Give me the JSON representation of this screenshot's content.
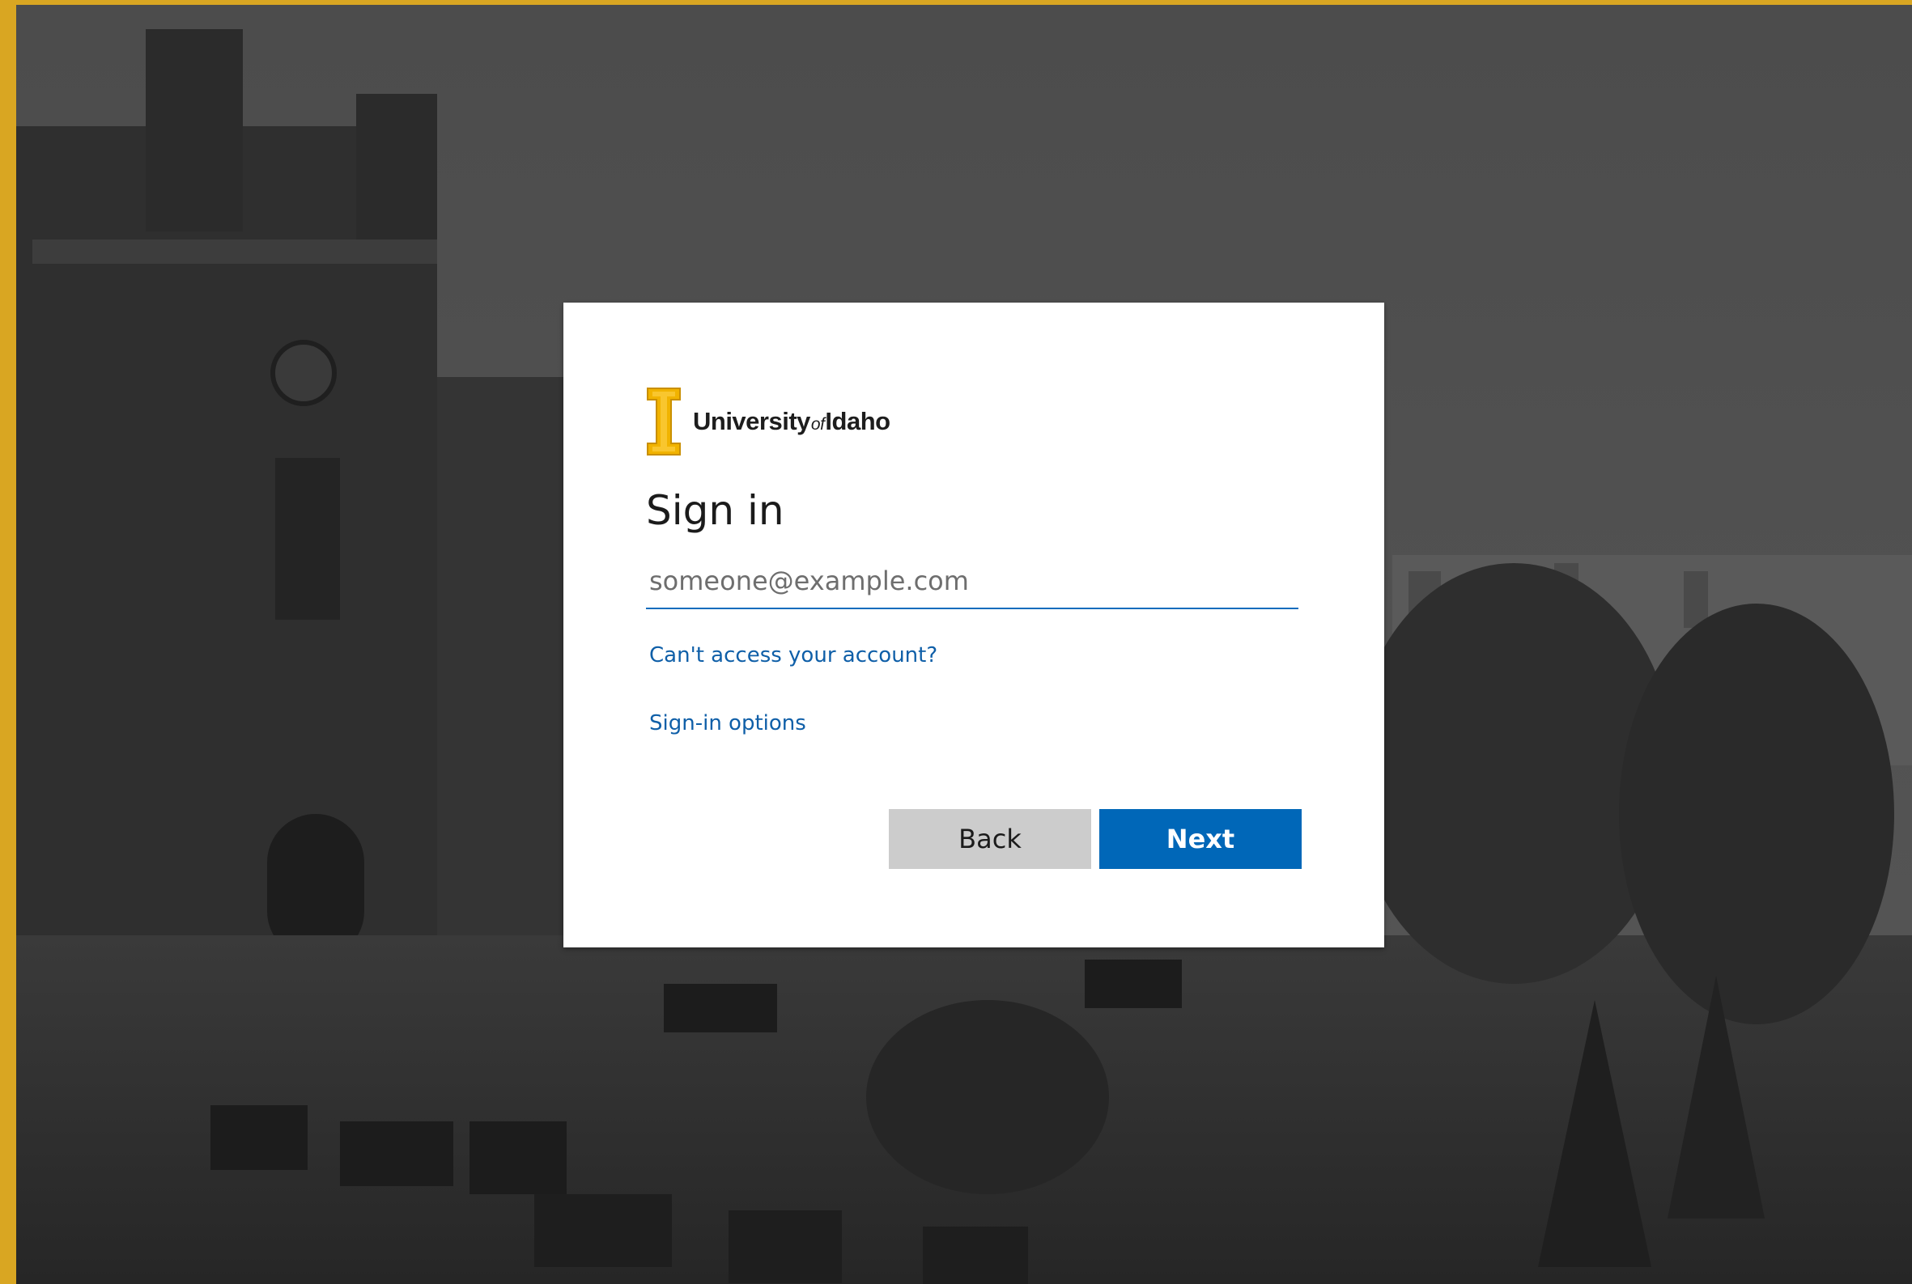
{
  "brand": {
    "name_part1": "University",
    "name_of": "of",
    "name_part2": "Idaho",
    "accent_color": "#f1b300",
    "frame_color": "#d9a622"
  },
  "signin": {
    "title": "Sign in",
    "email_placeholder": "someone@example.com",
    "email_value": "",
    "cant_access_link": "Can't access your account?",
    "options_link": "Sign-in options",
    "back_label": "Back",
    "next_label": "Next",
    "primary_color": "#0067b8"
  }
}
